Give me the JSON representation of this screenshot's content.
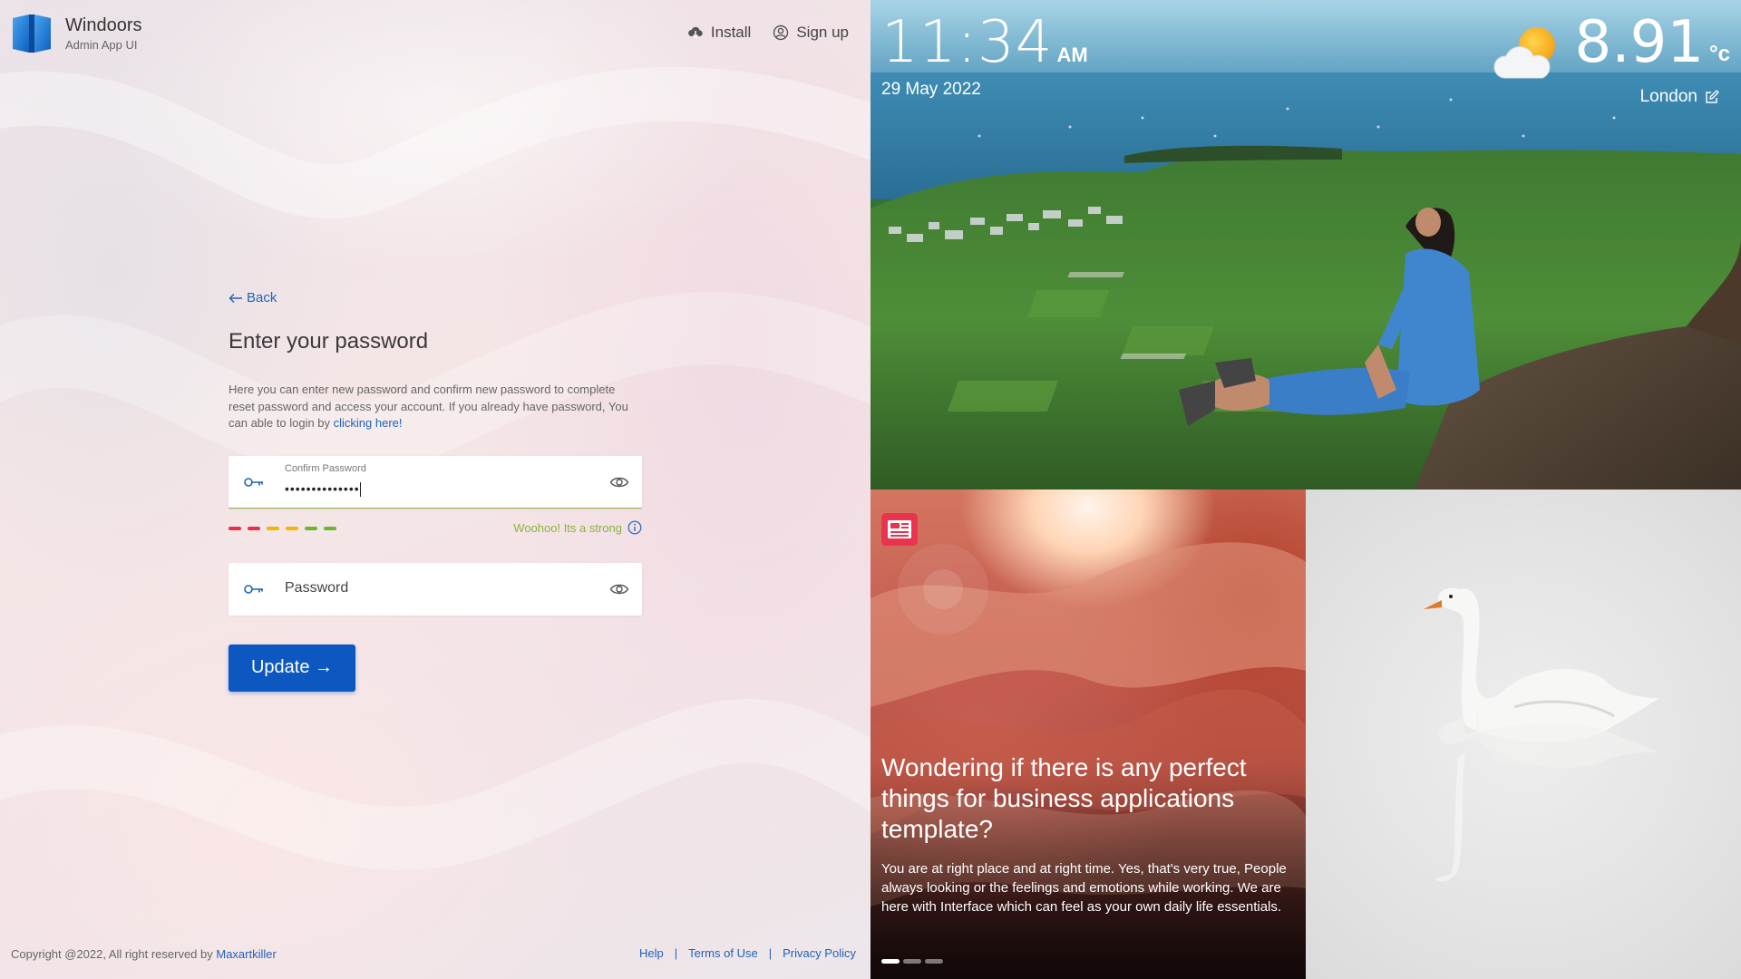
{
  "brand": {
    "name": "Windoors",
    "subtitle": "Admin App UI"
  },
  "topnav": {
    "install": "Install",
    "signup": "Sign up"
  },
  "form": {
    "back_label": "Back",
    "title": "Enter your password",
    "description": "Here you can enter new password and confirm new password to complete reset password and access your account. If you already have password, You can able to login by ",
    "description_link": "clicking here!",
    "confirm_label": "Confirm Password",
    "confirm_value": "••••••••••••••",
    "strength_text": "Woohoo! Its a strong",
    "strength_colors": [
      "#e5304a",
      "#e5304a",
      "#f2b705",
      "#f2b705",
      "#6cb52d",
      "#6cb52d"
    ],
    "password_placeholder": "Password",
    "update_label": "Update →"
  },
  "footer": {
    "copyright": "Copyright @2022, All right reserved by ",
    "author": "Maxartkiller",
    "help": "Help",
    "terms": "Terms of Use",
    "privacy": "Privacy Policy",
    "separator": "|"
  },
  "hero": {
    "time": "11:34",
    "ampm": "AM",
    "date": "29 May 2022",
    "temperature": "8.91",
    "unit": "°c",
    "city": "London",
    "weather_icon": "partly-cloudy-icon"
  },
  "news": {
    "title": "Wondering if there is any perfect things for business applications template?",
    "body": "You are at right place and at right time. Yes, that's very true, People always looking or the feelings and emotions while working. We are here with Interface which can feel as your own daily life essentials.",
    "slides": 3,
    "active_slide": 0
  },
  "colors": {
    "accent": "#0c57c0",
    "link": "#1f63b8",
    "success": "#8bb33a"
  }
}
